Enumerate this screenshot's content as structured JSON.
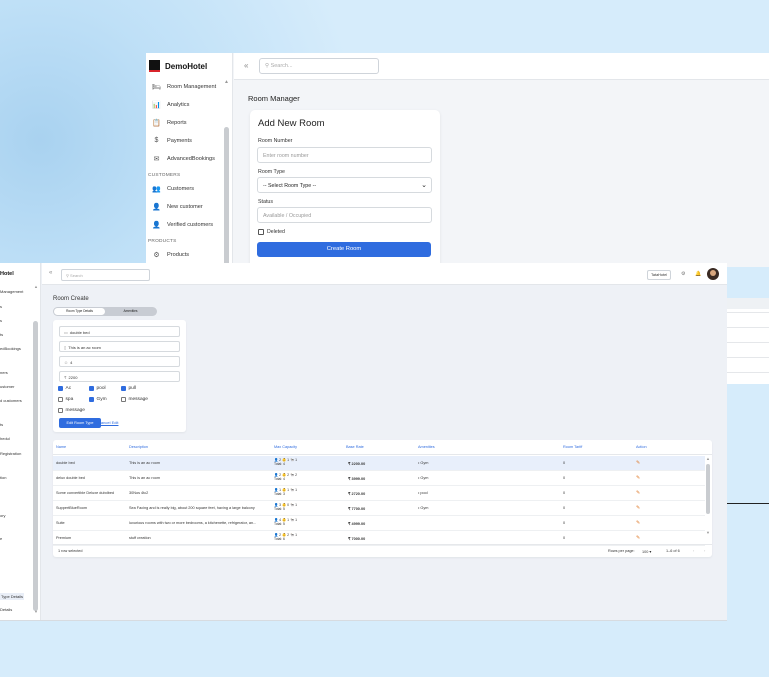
{
  "back_window": {
    "brand": "DemoHotel",
    "nav": [
      {
        "icon": "bed-icon",
        "glyph": "🛏",
        "label": "Room Management"
      },
      {
        "icon": "analytics-icon",
        "glyph": "📊",
        "label": "Analytics"
      },
      {
        "icon": "reports-icon",
        "glyph": "📋",
        "label": "Reports"
      },
      {
        "icon": "payments-icon",
        "glyph": "$",
        "label": "Payments"
      },
      {
        "icon": "bookings-icon",
        "glyph": "✉",
        "label": "AdvancedBookings"
      }
    ],
    "section_customers": "CUSTOMERS",
    "customers_nav": [
      {
        "icon": "users-icon",
        "glyph": "👥",
        "label": "Customers"
      },
      {
        "icon": "add-user-icon",
        "glyph": "👤",
        "label": "New customer"
      },
      {
        "icon": "verified-user-icon",
        "glyph": "👤",
        "label": "Verified customers"
      }
    ],
    "section_products": "PRODUCTS",
    "products_nav": [
      {
        "icon": "products-icon",
        "glyph": "⚙",
        "label": "Products"
      }
    ],
    "search_placeholder": "Search...",
    "page_title": "Room Manager",
    "form": {
      "title": "Add New Room",
      "room_number_label": "Room Number",
      "room_number_placeholder": "Enter room number",
      "room_type_label": "Room Type",
      "room_type_value": "-- Select Room Type --",
      "status_label": "Status",
      "status_placeholder": "Available / Occupied",
      "deleted_label": "Deleted",
      "submit_label": "Create Room"
    }
  },
  "front_window": {
    "brand": "Hotel",
    "sidebar_items": [
      "Management",
      "s",
      "s",
      "ts",
      "edBookings",
      "ners",
      "ustomer",
      "d customers",
      "ts",
      "hedul",
      "Registration",
      "tion",
      "ory",
      "e",
      "Type Details",
      "Details"
    ],
    "search_placeholder": "Search",
    "user_label": "TataHotel",
    "page_title": "Room Create",
    "tabs": [
      "Room Type Details",
      "Amenities"
    ],
    "form": {
      "name_value": "double bed",
      "description_value": "This is an ac room",
      "capacity_value": "4",
      "rate_value": "2200",
      "amenities": [
        {
          "label": "Ac",
          "checked": true
        },
        {
          "label": "pool",
          "checked": true
        },
        {
          "label": "pull",
          "checked": true
        },
        {
          "label": "spa",
          "checked": false
        },
        {
          "label": "Gym",
          "checked": true
        },
        {
          "label": "message",
          "checked": false
        },
        {
          "label": "message",
          "checked": false
        }
      ],
      "submit_label": "Edit Room Type",
      "cancel_label": "Cancel Edit"
    },
    "table": {
      "headers": [
        "Name",
        "Description",
        "Max Capacity",
        "Base Rate",
        "Amenities",
        "Room Tariff",
        "Action"
      ],
      "rows": [
        {
          "name": "double bed",
          "description": "This is an ac room",
          "cap1": "👤 2 👶 1 🐄 1",
          "cap2": "Total: 4",
          "rate": "₹ 2200.00",
          "amenity": "• Gym",
          "tariff": "0"
        },
        {
          "name": "delux double bed",
          "description": "This is an ac room",
          "cap1": "👤 2 👶 2 🐄 2",
          "cap2": "Total: 4",
          "rate": "₹ 3999.00",
          "amenity": "• Gym",
          "tariff": "0"
        },
        {
          "name": "Some convertible Deluxe dubdbed",
          "description": "30Nos 4tc2",
          "cap1": "👤 1 👶 1 🐄 1",
          "cap2": "Total: 3",
          "rate": "₹ 2720.00",
          "amenity": "• pool",
          "tariff": "0"
        },
        {
          "name": "SuppertBlueRoom",
          "description": "Sea Facing and is really big, about 200 square feet, having a large balcony",
          "cap1": "👤 3 👶 0 🐄 1",
          "cap2": "Total: 5",
          "rate": "₹ 7700.00",
          "amenity": "• Gym",
          "tariff": "0"
        },
        {
          "name": "Suite",
          "description": "luxurious rooms with two or more bedrooms, a kitchenette, refrigerator, an...",
          "cap1": "👤 4 👶 1 🐄 1",
          "cap2": "Total: 5",
          "rate": "₹ 4999.00",
          "amenity": "",
          "tariff": "0"
        },
        {
          "name": "Premium",
          "description": "stuff creation",
          "cap1": "👤 2 👶 2 🐄 1",
          "cap2": "Total: 6",
          "rate": "₹ 7000.00",
          "amenity": "",
          "tariff": "0"
        }
      ],
      "selected_text": "1 row selected",
      "rows_per_page_label": "Rows per page:",
      "rows_per_page_value": "100 ▾",
      "pagination": "1–6 of 6"
    }
  }
}
